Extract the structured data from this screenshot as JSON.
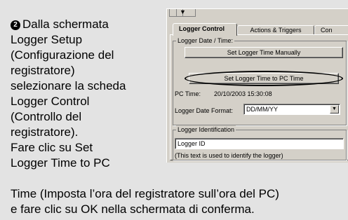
{
  "instruction": {
    "step_number": "❷",
    "lines": [
      "Dalla schermata",
      "Logger Setup",
      "(Configurazione del",
      "registratore)",
      "selezionare la scheda",
      "Logger Control",
      "(Controllo del",
      "registratore).",
      "Fare clic su Set",
      "Logger Time to PC"
    ],
    "tail_lines": [
      "Time (Imposta l’ora del registratore sull’ora del PC)",
      "e fare clic su OK nella schermata di conferma."
    ]
  },
  "dialog": {
    "tabs": [
      "Logger Control",
      "Actions & Triggers",
      "Con"
    ],
    "active_tab": "Logger Control",
    "date_time_group": {
      "label": "Logger Date / Time:",
      "set_manual_button": "Set Logger Time Manually",
      "set_pc_button": "Set Logger Time to PC Time",
      "pc_time_label": "PC Time:",
      "pc_time_value": "20/10/2003 15:30:08",
      "date_format_label": "Logger Date Format:",
      "date_format_value": "DD/MM/YY",
      "dropdown_icon": "chevron-down-icon"
    },
    "identification_group": {
      "label": "Logger Identification",
      "value": "Logger ID",
      "hint": "(This text is used to identify the logger)"
    }
  },
  "colors": {
    "page_background": "#e3e3e3",
    "dialog_face": "#d4d0c8",
    "highlight_oval": "#000000"
  }
}
